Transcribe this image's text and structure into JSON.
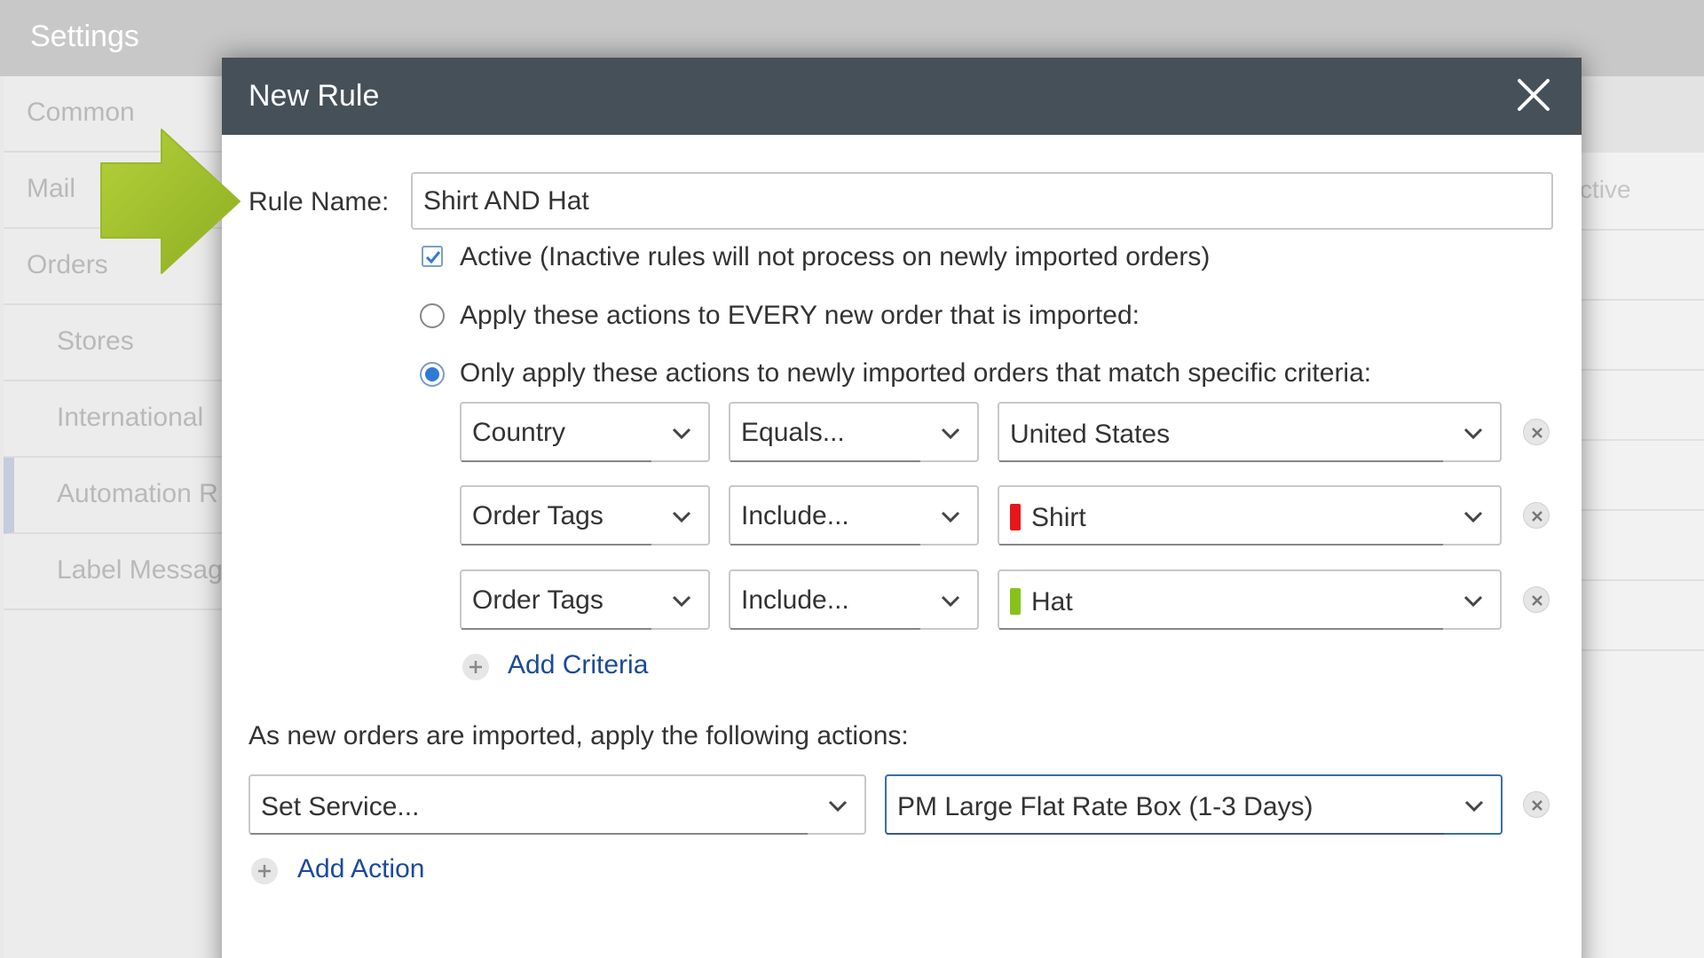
{
  "background": {
    "title": "Settings",
    "nav": [
      {
        "label": "Common"
      },
      {
        "label": "Mail"
      },
      {
        "label": "Orders"
      },
      {
        "label": "Stores"
      },
      {
        "label": "International"
      },
      {
        "label": "Automation R"
      },
      {
        "label": "Label Messag"
      }
    ],
    "column_header": "ctive"
  },
  "modal": {
    "title": "New Rule",
    "rule_name_label": "Rule Name:",
    "rule_name_value": "Shirt AND Hat",
    "active_label": "Active (Inactive rules will not process on newly imported orders)",
    "active_checked": true,
    "option_every": "Apply these actions to EVERY new order that is imported:",
    "option_specific": "Only apply these actions to newly imported orders that match specific criteria:",
    "selected_option": "specific",
    "criteria": [
      {
        "field": "Country",
        "operator": "Equals...",
        "value": "United States",
        "tag_color": null
      },
      {
        "field": "Order Tags",
        "operator": "Include...",
        "value": "Shirt",
        "tag_color": "#e8161a"
      },
      {
        "field": "Order Tags",
        "operator": "Include...",
        "value": "Hat",
        "tag_color": "#86c21a"
      }
    ],
    "add_criteria_label": "Add Criteria",
    "actions_label": "As new orders are imported, apply the following actions:",
    "action": {
      "type": "Set Service...",
      "value": "PM Large Flat Rate Box (1-3 Days)"
    },
    "add_action_label": "Add Action"
  },
  "colors": {
    "header_bg": "#465058",
    "link": "#1a4a9a",
    "radio_selected": "#2f7bd4",
    "arrow": "#9bbf2a"
  }
}
